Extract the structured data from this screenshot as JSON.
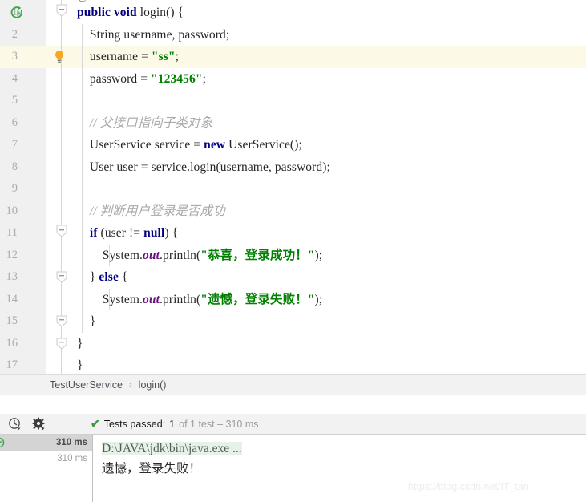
{
  "editor": {
    "clipped_top_line": "@Test",
    "lines": [
      {
        "num": "1",
        "indent": 0,
        "tokens": [
          {
            "t": "kw",
            "v": "public"
          },
          {
            "t": "plain",
            "v": " "
          },
          {
            "t": "kw",
            "v": "void"
          },
          {
            "t": "plain",
            "v": " login() {"
          }
        ],
        "fold": "collapse",
        "run_icon": true
      },
      {
        "num": "2",
        "indent": 1,
        "tokens": [
          {
            "t": "plain",
            "v": "String username, password;"
          }
        ]
      },
      {
        "num": "3",
        "indent": 1,
        "tokens": [
          {
            "t": "plain",
            "v": "username = "
          },
          {
            "t": "str",
            "v": "\"ss\""
          },
          {
            "t": "plain",
            "v": ";"
          }
        ],
        "highlight": true,
        "bulb": true
      },
      {
        "num": "4",
        "indent": 1,
        "tokens": [
          {
            "t": "plain",
            "v": "password = "
          },
          {
            "t": "str",
            "v": "\"123456\""
          },
          {
            "t": "plain",
            "v": ";"
          }
        ]
      },
      {
        "num": "5",
        "indent": 1,
        "tokens": []
      },
      {
        "num": "6",
        "indent": 1,
        "tokens": [
          {
            "t": "cmt",
            "v": "// 父接口指向子类对象"
          }
        ]
      },
      {
        "num": "7",
        "indent": 1,
        "tokens": [
          {
            "t": "plain",
            "v": "UserService service = "
          },
          {
            "t": "kw",
            "v": "new"
          },
          {
            "t": "plain",
            "v": " UserService();"
          }
        ]
      },
      {
        "num": "8",
        "indent": 1,
        "tokens": [
          {
            "t": "plain",
            "v": "User user = service.login(username, password);"
          }
        ]
      },
      {
        "num": "9",
        "indent": 1,
        "tokens": []
      },
      {
        "num": "10",
        "indent": 1,
        "tokens": [
          {
            "t": "cmt",
            "v": "// 判断用户登录是否成功"
          }
        ]
      },
      {
        "num": "11",
        "indent": 1,
        "tokens": [
          {
            "t": "kw",
            "v": "if"
          },
          {
            "t": "plain",
            "v": " (user != "
          },
          {
            "t": "kw",
            "v": "null"
          },
          {
            "t": "plain",
            "v": ") {"
          }
        ],
        "fold": "collapse"
      },
      {
        "num": "12",
        "indent": 2,
        "tokens": [
          {
            "t": "plain",
            "v": "System."
          },
          {
            "t": "fld",
            "v": "out"
          },
          {
            "t": "plain",
            "v": ".println("
          },
          {
            "t": "str",
            "v": "\"恭喜，登录成功！\""
          },
          {
            "t": "plain",
            "v": ");"
          }
        ]
      },
      {
        "num": "13",
        "indent": 1,
        "tokens": [
          {
            "t": "plain",
            "v": "} "
          },
          {
            "t": "kw",
            "v": "else"
          },
          {
            "t": "plain",
            "v": " {"
          }
        ],
        "fold": "collapse-small"
      },
      {
        "num": "14",
        "indent": 2,
        "tokens": [
          {
            "t": "plain",
            "v": "System."
          },
          {
            "t": "fld",
            "v": "out"
          },
          {
            "t": "plain",
            "v": ".println("
          },
          {
            "t": "str",
            "v": "\"遗憾，登录失败！\""
          },
          {
            "t": "plain",
            "v": ");"
          }
        ]
      },
      {
        "num": "15",
        "indent": 1,
        "tokens": [
          {
            "t": "plain",
            "v": "}"
          }
        ],
        "fold": "collapse-small"
      },
      {
        "num": "16",
        "indent": 0,
        "tokens": [
          {
            "t": "plain",
            "v": "}"
          }
        ],
        "fold": "collapse-small"
      },
      {
        "num": "17",
        "indent": 0,
        "tokens": [
          {
            "t": "plain",
            "v": "}"
          }
        ],
        "outdent": true
      }
    ]
  },
  "breadcrumb": {
    "class": "TestUserService",
    "separator": "›",
    "method": "login()"
  },
  "runner": {
    "icons": {
      "history": "history-clock-icon",
      "settings": "gear-icon"
    },
    "status": {
      "tick": "✔",
      "label": "Tests passed:",
      "count": "1",
      "detail": "of 1 test – 310 ms"
    },
    "tree": [
      {
        "label": "",
        "duration": "310 ms",
        "selected": true,
        "child": false
      },
      {
        "label": "",
        "duration": "310 ms",
        "selected": false,
        "child": true
      }
    ]
  },
  "console": {
    "command": "D:\\JAVA\\jdk\\bin\\java.exe ...",
    "output": "遗憾，登录失败！"
  },
  "watermark": "https://blog.csdn.net/IT_tan",
  "colors": {
    "keyword": "#000080",
    "string": "#008000",
    "comment": "#a8a8a8",
    "annotation": "#808000",
    "field": "#660e7a",
    "gutter_bg": "#f0f0f0",
    "highlight_line": "#fcfae6",
    "pass_green": "#3c9b3c",
    "console_cmd_bg": "#e6f2e6",
    "bulb_yellow": "#f5a623"
  }
}
